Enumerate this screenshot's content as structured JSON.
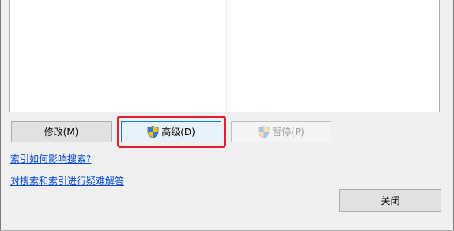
{
  "buttons": {
    "modify_label": "修改(M)",
    "advanced_label": "高级(D)",
    "pause_label": "暂停(P)",
    "close_label": "关闭"
  },
  "links": {
    "how_indexing_affects_search": "索引如何影响搜索?",
    "troubleshoot_search_indexing": "对搜索和索引进行疑难解答"
  },
  "icons": {
    "advanced": "uac-shield-icon",
    "pause": "uac-shield-icon"
  },
  "colors": {
    "highlight": "#e3202a",
    "link": "#0046d5",
    "focus_border": "#0078d7"
  }
}
